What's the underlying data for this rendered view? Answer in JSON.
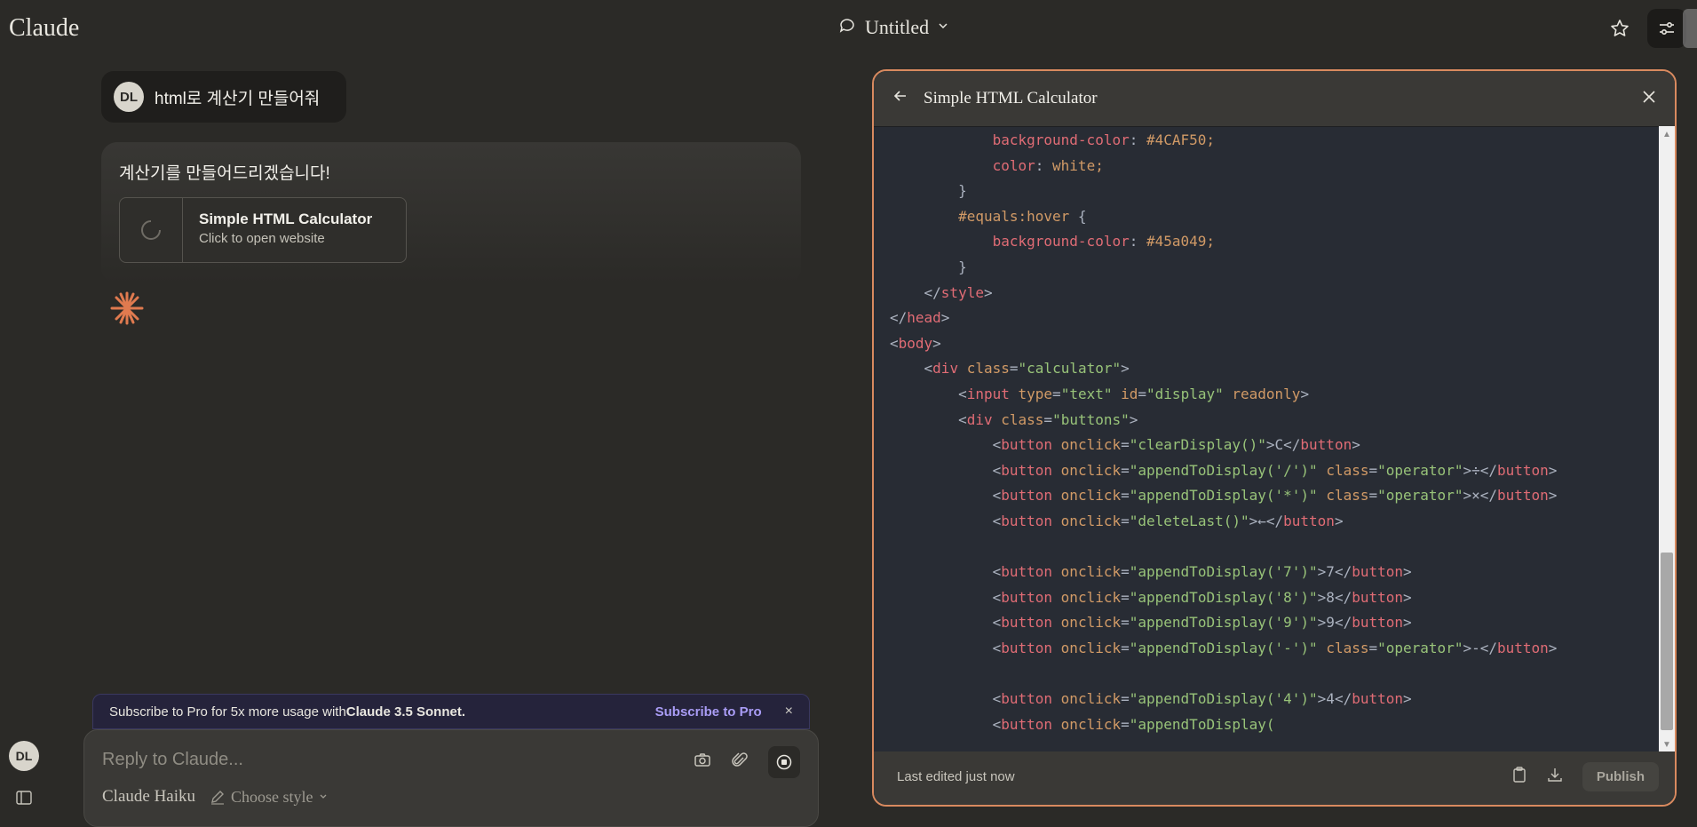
{
  "header": {
    "logo": "Claude",
    "title": "Untitled",
    "icons": [
      "chat-icon",
      "chevron-down-icon",
      "star-icon",
      "tune-icon"
    ]
  },
  "chat": {
    "user": {
      "initials": "DL",
      "message": "html로 계산기 만들어줘"
    },
    "assistant": {
      "message": "계산기를 만들어드리겠습니다!",
      "artifact": {
        "title": "Simple HTML Calculator",
        "subtitle": "Click to open website"
      }
    }
  },
  "promo": {
    "text_prefix": "Subscribe to Pro for 5x more usage with ",
    "text_bold": "Claude 3.5 Sonnet.",
    "cta": "Subscribe to Pro",
    "close": "×"
  },
  "composer": {
    "placeholder": "Reply to Claude...",
    "model": "Claude Haiku",
    "style_label": "Choose style"
  },
  "sidebar": {
    "initials": "DL"
  },
  "artifact_panel": {
    "title": "Simple HTML Calculator",
    "footer_status": "Last edited just now",
    "publish_label": "Publish",
    "code_lines": [
      "            background-color: #4CAF50;",
      "            color: white;",
      "        }",
      "        #equals:hover {",
      "            background-color: #45a049;",
      "        }",
      "    </style>",
      "</head>",
      "<body>",
      "    <div class=\"calculator\">",
      "        <input type=\"text\" id=\"display\" readonly>",
      "        <div class=\"buttons\">",
      "            <button onclick=\"clearDisplay()\">C</button>",
      "            <button onclick=\"appendToDisplay('/')\" class=\"operator\">÷</button>",
      "            <button onclick=\"appendToDisplay('*')\" class=\"operator\">×</button>",
      "            <button onclick=\"deleteLast()\">←</button>",
      "",
      "            <button onclick=\"appendToDisplay('7')\">7</button>",
      "            <button onclick=\"appendToDisplay('8')\">8</button>",
      "            <button onclick=\"appendToDisplay('9')\">9</button>",
      "            <button onclick=\"appendToDisplay('-')\" class=\"operator\">-</button>",
      "",
      "            <button onclick=\"appendToDisplay('4')\">4</button>",
      "            <button onclick=\"appendToDisplay("
    ]
  },
  "colors": {
    "background": "#2b2a27",
    "panel_border": "#d98a5f",
    "code_background": "#282c34",
    "accent_purple": "#a99cf5",
    "spark": "#e07a4f"
  }
}
